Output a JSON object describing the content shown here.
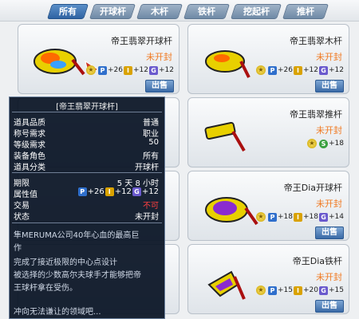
{
  "tabs": [
    "所有",
    "开球杆",
    "木杆",
    "铁杆",
    "挖起杆",
    "推杆"
  ],
  "cards": [
    {
      "name": "帝王翡翠开球杆",
      "status": "未开封",
      "stats": {
        "p": "+26",
        "i": "+12",
        "g": "+12"
      },
      "sell": "出售"
    },
    {
      "name": "帝王翡翠木杆",
      "status": "未开封",
      "stats": {
        "p": "+26",
        "i": "+12",
        "g": "+12"
      },
      "sell": "出售"
    },
    {
      "name": "",
      "status": "",
      "stats": {
        "p": "",
        "i": "",
        "g": ""
      },
      "sell": ""
    },
    {
      "name": "帝王翡翠推杆",
      "status": "未开封",
      "stats": {
        "s": "+18"
      },
      "sell": "出售"
    },
    {
      "name": "",
      "status": "",
      "stats": {
        "p": "",
        "i": "",
        "g": ""
      },
      "sell": ""
    },
    {
      "name": "帝王Dia开球杆",
      "status": "未开封",
      "stats": {
        "p": "+18",
        "i": "+18",
        "g": "+14"
      },
      "sell": "出售"
    },
    {
      "name": "",
      "status": "",
      "stats": {},
      "sell": ""
    },
    {
      "name": "帝王Dia铁杆",
      "status": "未开封",
      "stats": {
        "p": "+15",
        "i": "+20",
        "g": "+15"
      },
      "sell": "出售"
    }
  ],
  "tooltip": {
    "title": "[帝王翡翠开球杆]",
    "rows": [
      {
        "k": "道具品质",
        "v": "普通"
      },
      {
        "k": "称号需求",
        "v": "职业"
      },
      {
        "k": "等级需求",
        "v": "50"
      },
      {
        "k": "装备角色",
        "v": "所有"
      },
      {
        "k": "道具分类",
        "v": "开球杆"
      },
      {
        "k": "期限",
        "v": "5 天 8 小时"
      },
      {
        "k": "属性值",
        "v": ""
      },
      {
        "k": "交易",
        "v": "不可"
      },
      {
        "k": "状态",
        "v": "未开封"
      }
    ],
    "attr": {
      "p": "+26",
      "i": "+12",
      "g": "+12"
    },
    "desc": [
      "隼MERUMA公司40年心血的最高巨",
      "作",
      "完成了接近极限的中心点设计",
      "被选择的少数高尔夫球手才能够把帝",
      "王球杆拿在受伤。",
      "",
      "冲向无法谦让的领域吧..."
    ]
  },
  "colors": {
    "status": "#f07a22",
    "accent": "#2f63a3",
    "trade_no": "#ff4040"
  }
}
